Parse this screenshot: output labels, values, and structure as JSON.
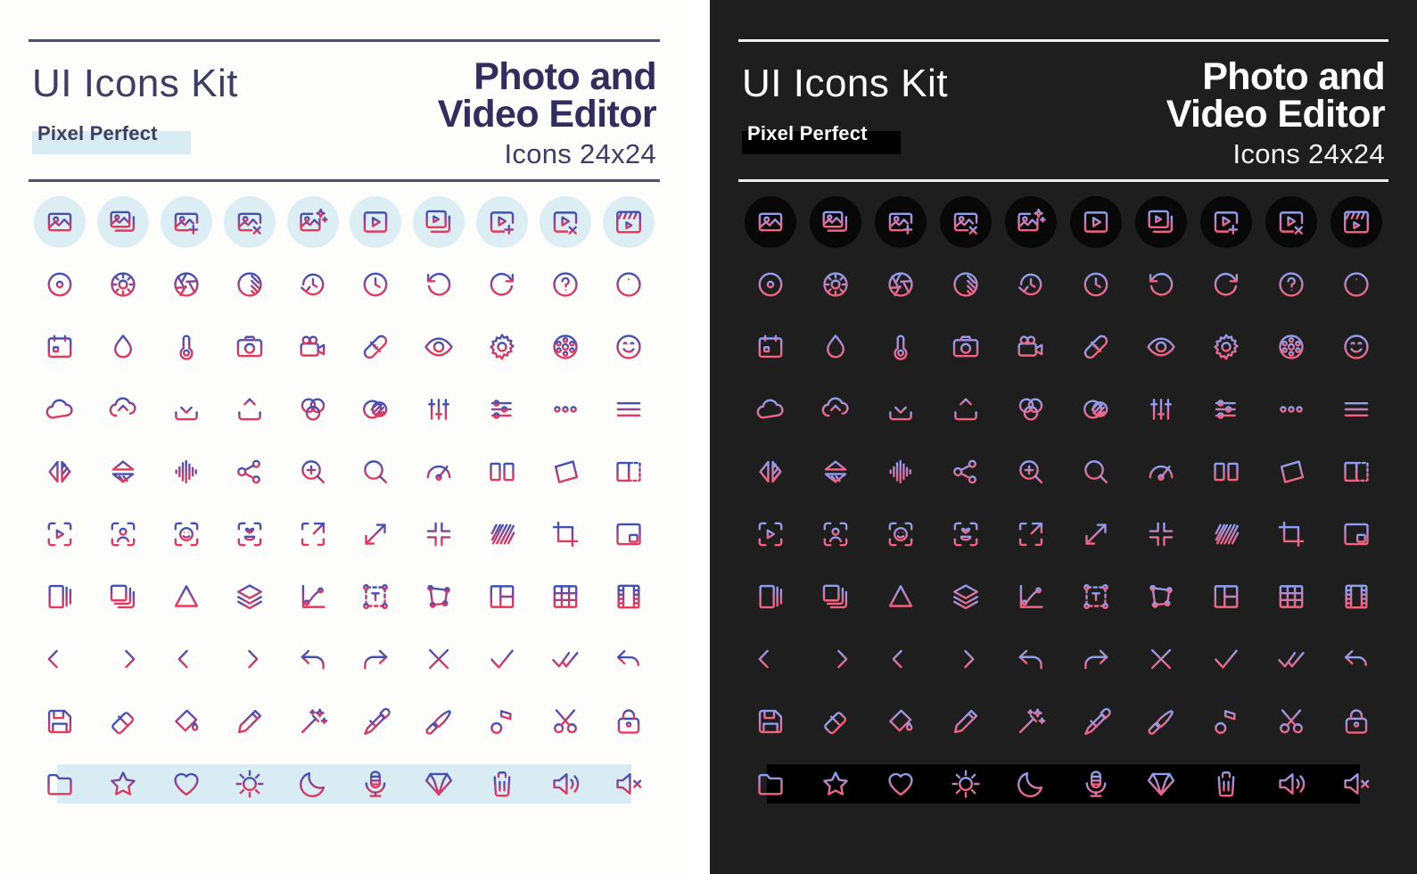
{
  "meta": {
    "kit_title": "UI Icons Kit",
    "pixel_perfect": "Pixel Perfect",
    "category_line1": "Photo and",
    "category_line2": "Video Editor",
    "size_label": "Icons 24x24"
  },
  "colors": {
    "light_panel_bg": "#fdfdfb",
    "dark_panel_bg": "#1e1e1e",
    "light_badge": "#dcedf4",
    "dark_badge": "#080808",
    "light_highlight": "#d9ecf4",
    "dark_highlight": "#000000",
    "title_navy": "#3e3d62",
    "category_navy": "#312e5e",
    "rule_light": "#50506e",
    "rule_dark": "#efefef",
    "gradient_light_start": "#3f51b5",
    "gradient_light_end": "#e8395c",
    "gradient_dark_start": "#8f9ff0",
    "gradient_dark_end": "#f4607e"
  },
  "grid": {
    "columns": 10,
    "rows": 10,
    "badged_row_index": 0,
    "highlight_row_index": 9,
    "icons": [
      "image",
      "images-stack",
      "image-add",
      "image-remove",
      "image-magic",
      "video",
      "videos-stack",
      "video-add",
      "video-remove",
      "clapperboard",
      "lens-dot",
      "color-wheel",
      "aperture",
      "contrast",
      "history-clock",
      "clock",
      "rotate-left",
      "rotate-right",
      "help-circle",
      "info-circle",
      "calendar",
      "water-drop",
      "thermometer",
      "camera",
      "video-camera",
      "bandage",
      "eye",
      "gear",
      "film-reel",
      "smiley-face",
      "cloud",
      "cloud-upload",
      "download",
      "share-upload",
      "color-mix",
      "blend-modes",
      "vertical-sliders",
      "horizontal-sliders",
      "more-dots",
      "menu-hamburger",
      "flip-horizontal",
      "flip-vertical",
      "waveform",
      "share-network",
      "zoom-in",
      "zoom-out",
      "speedometer",
      "split-view",
      "skew-transform",
      "mask-panel",
      "focus-video",
      "focus-person",
      "focus-face",
      "focus-macro",
      "expand-corner",
      "resize-diagonal",
      "collapse-crosshair",
      "texture-stripes",
      "crop",
      "picture-in-picture",
      "page-split",
      "copy-layers",
      "triangle-shape",
      "layers-stack",
      "curve-graph",
      "text-box",
      "transform-points",
      "layout-grid",
      "grid-table",
      "film-strip",
      "arrow-left",
      "arrow-right",
      "arrow-to-start",
      "arrow-to-end",
      "undo",
      "redo",
      "close-x",
      "check",
      "double-check",
      "revert-arrow",
      "save-floppy",
      "eraser",
      "paint-bucket",
      "pencil",
      "magic-wand",
      "eyedropper",
      "paintbrush",
      "music-note",
      "scissors",
      "lock",
      "folder",
      "star",
      "heart",
      "sun",
      "moon",
      "microphone",
      "diamond",
      "trash",
      "volume-on",
      "volume-mute"
    ]
  }
}
